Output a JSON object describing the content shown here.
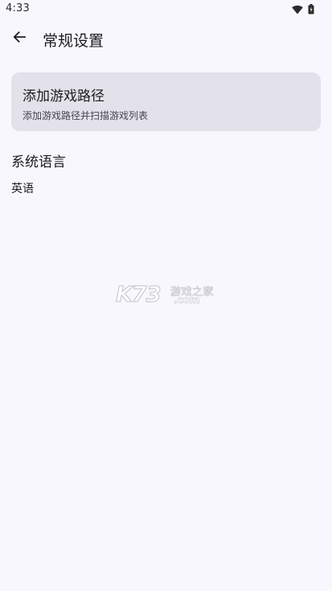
{
  "status_bar": {
    "time": "4:33",
    "icons": [
      "wifi-icon",
      "battery-icon"
    ]
  },
  "app_bar": {
    "back_icon": "arrow-back-icon",
    "title": "常规设置"
  },
  "add_game_path": {
    "title": "添加游戏路径",
    "subtitle": "添加游戏路径并扫描游戏列表"
  },
  "language": {
    "section_title": "系统语言",
    "value": "英语"
  },
  "watermark": {
    "brand": "K73",
    "name": "游戏之家",
    "domain": ".com"
  },
  "colors": {
    "background": "#f8f7fd",
    "card": "#e3e2ea",
    "text": "#1c1b1f"
  }
}
